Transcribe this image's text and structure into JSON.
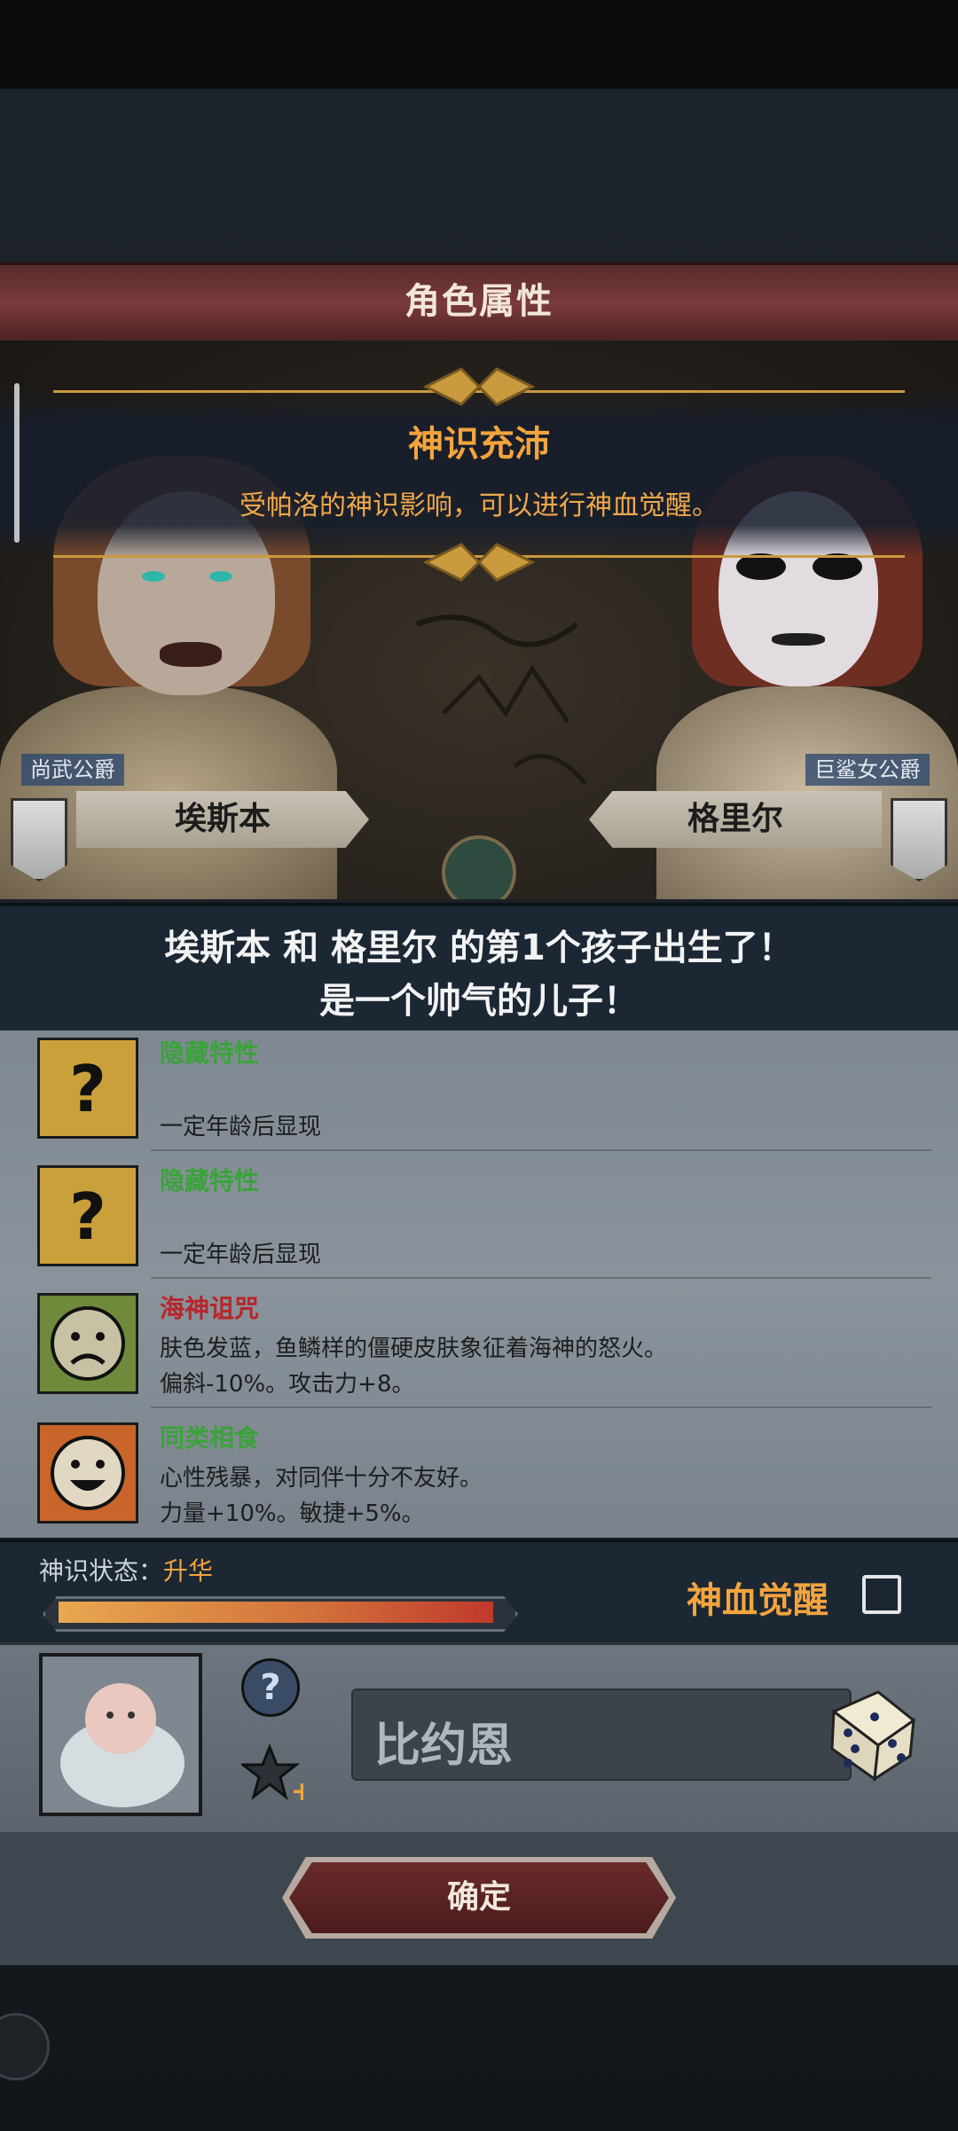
{
  "header": {
    "title": "角色属性"
  },
  "banner": {
    "title": "神识充沛",
    "description": "受帕洛的神识影响，可以进行神血觉醒。"
  },
  "parents": {
    "father": {
      "title": "尚武公爵",
      "name": "埃斯本"
    },
    "mother": {
      "title": "巨鲨女公爵",
      "name": "格里尔"
    }
  },
  "birth": {
    "line1": "埃斯本 和 格里尔 的第1个孩子出生了！",
    "line2": "是一个帅气的儿子！"
  },
  "traits": [
    {
      "name": "隐藏特性",
      "lines": [
        "",
        "一定年龄后显现"
      ],
      "icon": "question-mark-icon",
      "name_color": "#3aa33a"
    },
    {
      "name": "隐藏特性",
      "lines": [
        "",
        "一定年龄后显现"
      ],
      "icon": "question-mark-icon",
      "name_color": "#3aa33a"
    },
    {
      "name": "海神诅咒",
      "lines": [
        "肤色发蓝，鱼鳞样的僵硬皮肤象征着海神的怒火。",
        "偏斜-10%。攻击力+8。"
      ],
      "icon": "sad-face-icon",
      "name_color": "#b8252b"
    },
    {
      "name": "同类相食",
      "lines": [
        "心性残暴，对同伴十分不友好。",
        "力量+10%。敏捷+5%。"
      ],
      "icon": "grin-face-icon",
      "name_color": "#3aa33a"
    }
  ],
  "status": {
    "label": "神识状态：",
    "value": "升华",
    "progress": 1.0,
    "awaken_label": "神血觉醒"
  },
  "child": {
    "name": "比约恩"
  },
  "confirm_label": "确定",
  "colors": {
    "accent": "#f3a43d",
    "banner_title": "#f3a43d"
  }
}
